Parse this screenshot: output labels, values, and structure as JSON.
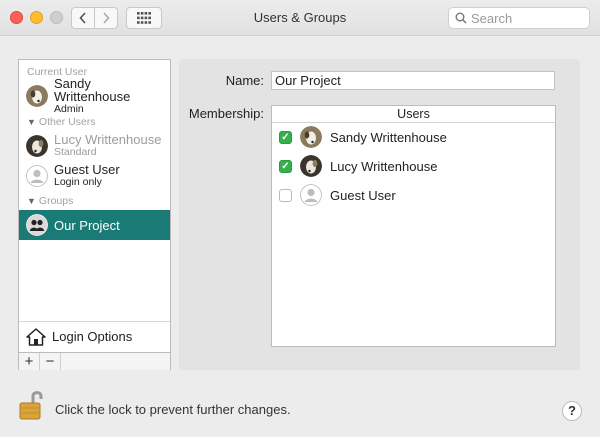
{
  "window": {
    "title": "Users & Groups"
  },
  "search": {
    "placeholder": "Search"
  },
  "sidebar": {
    "current_user_label": "Current User",
    "current_user": {
      "name": "Sandy Writtenhouse",
      "role": "Admin"
    },
    "other_users_label": "Other Users",
    "other_users": [
      {
        "name": "Lucy Writtenhouse",
        "role": "Standard"
      },
      {
        "name": "Guest User",
        "role": "Login only"
      }
    ],
    "groups_label": "Groups",
    "groups": [
      {
        "name": "Our Project",
        "selected": true
      }
    ],
    "login_options_label": "Login Options",
    "add_label": "+",
    "remove_label": "−"
  },
  "group_detail": {
    "name_label": "Name:",
    "name_value": "Our Project",
    "membership_label": "Membership:",
    "users_header": "Users",
    "members": [
      {
        "name": "Sandy Writtenhouse",
        "checked": true
      },
      {
        "name": "Lucy Writtenhouse",
        "checked": true
      },
      {
        "name": "Guest User",
        "checked": false
      }
    ]
  },
  "footer": {
    "lock_text": "Click the lock to prevent further changes.",
    "help_label": "?"
  },
  "colors": {
    "selection": "#1a7b76",
    "checkbox_on": "#36b04a"
  }
}
